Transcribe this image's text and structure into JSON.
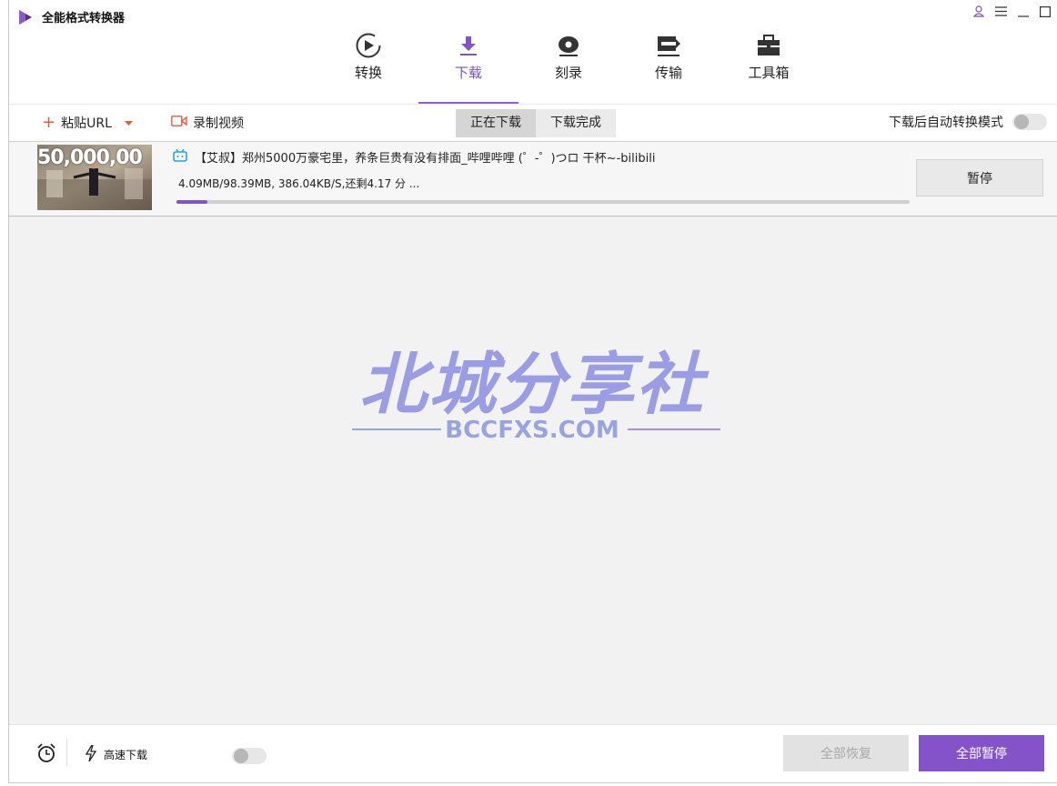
{
  "app": {
    "title": "全能格式转换器",
    "brand_color": "#8452c9"
  },
  "nav": {
    "items": [
      {
        "label": "转换",
        "icon": "convert-icon"
      },
      {
        "label": "下载",
        "icon": "download-icon",
        "active": true
      },
      {
        "label": "刻录",
        "icon": "burn-disc-icon"
      },
      {
        "label": "传输",
        "icon": "transfer-icon"
      },
      {
        "label": "工具箱",
        "icon": "toolbox-icon"
      }
    ]
  },
  "toolbar": {
    "paste_url_label": "粘贴URL",
    "record_label": "录制视频",
    "tab_downloading": "正在下载",
    "tab_done": "下载完成",
    "auto_convert_label": "下载后自动转换模式",
    "auto_convert_on": false
  },
  "downloads": [
    {
      "thumbnail_text": "50,000,00",
      "title": "【艾叔】郑州5000万豪宅里，养条巨贵有没有排面_哔哩哔哩 (゜-゜)つロ 干杯~-bilibili",
      "progress_text": "4.09MB/98.39MB, 386.04KB/S,还剩4.17 分 ...",
      "progress_fraction": 0.0416,
      "action_label": "暂停",
      "source_icon": "bilibili-icon"
    }
  ],
  "watermark": {
    "title": "北城分享社",
    "subtitle": "BCCFXS.COM"
  },
  "footer": {
    "high_speed_label": "高速下载",
    "high_speed_on": false,
    "resume_all_label": "全部恢复",
    "pause_all_label": "全部暂停"
  }
}
